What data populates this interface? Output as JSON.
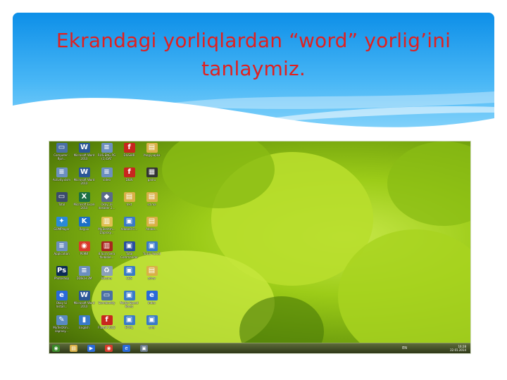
{
  "slide": {
    "title": "Ekrandagi yorliqlardan “word” yorlig’ini tanlaymiz."
  },
  "desktop": {
    "icons": [
      {
        "label": "Computer - Ярл...",
        "icon": "computer-icon",
        "color": "#4a6fa5",
        "glyph": "▭"
      },
      {
        "label": "Microsoft Word 2010",
        "icon": "word-icon",
        "color": "#2b5797",
        "glyph": "W"
      },
      {
        "label": "RUS-ENG PG (1).DAT",
        "icon": "document-icon",
        "color": "#6c8fc0",
        "glyph": "≡"
      },
      {
        "label": "DILSHIR",
        "icon": "flash-icon",
        "color": "#c8261e",
        "glyph": "f"
      },
      {
        "label": "Yangi papka",
        "icon": "folder-icon",
        "color": "#d9b046",
        "glyph": "▤"
      },
      {
        "label": "Activity.xlsm",
        "icon": "document-icon",
        "color": "#6c8fc0",
        "glyph": "≡"
      },
      {
        "label": "Microsoft Word 2010",
        "icon": "word-icon",
        "color": "#2b5797",
        "glyph": "W"
      },
      {
        "label": "video",
        "icon": "document-icon",
        "color": "#6c8fc0",
        "glyph": "≡"
      },
      {
        "label": "DILN",
        "icon": "flash-icon",
        "color": "#c8261e",
        "glyph": "f"
      },
      {
        "label": "galiru",
        "icon": "film-icon",
        "color": "#333333",
        "glyph": "▦"
      },
      {
        "label": "Total",
        "icon": "monitor-icon",
        "color": "#3a4a6a",
        "glyph": "▭"
      },
      {
        "label": "Microsoft Excel 2010",
        "icon": "excel-icon",
        "color": "#1d7044",
        "glyph": "X"
      },
      {
        "label": "Okay_Ui Installer 2...",
        "icon": "installer-icon",
        "color": "#5a6a8a",
        "glyph": "◆"
      },
      {
        "label": "test",
        "icon": "folder-icon",
        "color": "#d9b046",
        "glyph": "▤"
      },
      {
        "label": "sd.ma",
        "icon": "folder-icon",
        "color": "#d9b046",
        "glyph": "▤"
      },
      {
        "label": "GOMPlayer",
        "icon": "player-icon",
        "color": "#2a8ad8",
        "glyph": "✦"
      },
      {
        "label": "Reypix",
        "icon": "k-icon",
        "color": "#1b6fc6",
        "glyph": "K"
      },
      {
        "label": "MyTestXm... Zaprosy...",
        "icon": "book-icon",
        "color": "#e0c050",
        "glyph": "▥"
      },
      {
        "label": "AdobeR-Fi...",
        "icon": "app-icon",
        "color": "#3a7ac8",
        "glyph": "▣"
      },
      {
        "label": "Adobe...",
        "icon": "folder-icon",
        "color": "#d9b046",
        "glyph": "▤"
      },
      {
        "label": "Application",
        "icon": "document-icon",
        "color": "#6c8fc0",
        "glyph": "≡"
      },
      {
        "label": "РЕМИ",
        "icon": "chrome-icon",
        "color": "#d93a2b",
        "glyph": "◉"
      },
      {
        "label": "8 Sura Sera filebible...",
        "icon": "book-icon",
        "color": "#a8261e",
        "glyph": "▥"
      },
      {
        "label": "Total Commander",
        "icon": "floppy-icon",
        "color": "#2a4ea0",
        "glyph": "▣"
      },
      {
        "label": "Turbo Pascal",
        "icon": "app-icon",
        "color": "#3a7ac8",
        "glyph": "▣"
      },
      {
        "label": "Photoshop",
        "icon": "photoshop-icon",
        "color": "#0b2a55",
        "glyph": "Ps"
      },
      {
        "label": "DDSCH 2M",
        "icon": "document-icon",
        "color": "#6c8fc0",
        "glyph": "≡"
      },
      {
        "label": "Korzina",
        "icon": "recycle-bin-icon",
        "color": "#8aa0b8",
        "glyph": "♻"
      },
      {
        "label": "CDS",
        "icon": "app-icon",
        "color": "#3a7ac8",
        "glyph": "▣"
      },
      {
        "label": "zdrav",
        "icon": "folder-icon",
        "color": "#d9b046",
        "glyph": "▤"
      },
      {
        "label": "Okay Ui Install...",
        "icon": "ie-icon",
        "color": "#2a6ad8",
        "glyph": "e"
      },
      {
        "label": "Microsoft Word 2010",
        "icon": "word-icon",
        "color": "#2b5797",
        "glyph": "W"
      },
      {
        "label": "Somebuddy",
        "icon": "computer-icon",
        "color": "#4a6fa5",
        "glyph": "▭"
      },
      {
        "label": "Media Speed Boost",
        "icon": "app-icon",
        "color": "#3a7ac8",
        "glyph": "▣"
      },
      {
        "label": "Index",
        "icon": "ie-icon",
        "color": "#2a6ad8",
        "glyph": "e"
      },
      {
        "label": "MyTestXm... zaprosy...",
        "icon": "tool-icon",
        "color": "#5a8ac0",
        "glyph": "✎"
      },
      {
        "label": "English",
        "icon": "bottle-icon",
        "color": "#3a7ac8",
        "glyph": "▮"
      },
      {
        "label": "FlashX 2012",
        "icon": "flash-icon",
        "color": "#c8261e",
        "glyph": "f"
      },
      {
        "label": "HTML",
        "icon": "app-icon",
        "color": "#3a7ac8",
        "glyph": "▣"
      },
      {
        "label": "ariel",
        "icon": "app-icon",
        "color": "#3a7ac8",
        "glyph": "▣"
      }
    ],
    "taskbar": {
      "items": [
        {
          "icon": "start-button-icon",
          "color": "#3a8a2a",
          "glyph": "◉"
        },
        {
          "icon": "explorer-icon",
          "color": "#d9b046",
          "glyph": "▤"
        },
        {
          "icon": "media-player-icon",
          "color": "#2a6ad8",
          "glyph": "▶"
        },
        {
          "icon": "chrome-icon",
          "color": "#d93a2b",
          "glyph": "◉"
        },
        {
          "icon": "ie-icon",
          "color": "#2a6ad8",
          "glyph": "e"
        },
        {
          "icon": "app-icon",
          "color": "#6a7a8a",
          "glyph": "▣"
        }
      ],
      "language": "EN",
      "time": "16:28",
      "date": "22.01.2014"
    }
  }
}
